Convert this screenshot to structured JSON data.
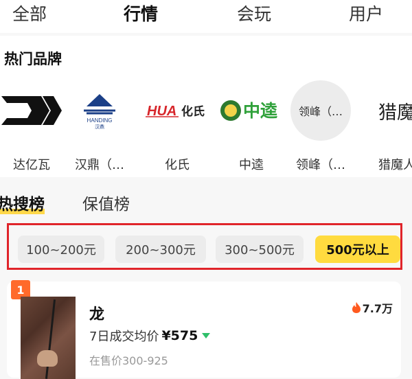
{
  "top_tabs": [
    {
      "label": "全部"
    },
    {
      "label": "行情"
    },
    {
      "label": "会玩"
    },
    {
      "label": "用户"
    }
  ],
  "brands_section": {
    "title": "热门品牌",
    "items": [
      {
        "name": "达亿瓦",
        "logo_text": "D"
      },
      {
        "name": "汉鼎（…",
        "logo_text": "HANDING 汉鼎"
      },
      {
        "name": "化氏",
        "logo_text": "HUA 化氏"
      },
      {
        "name": "中逵",
        "logo_text": "中逵"
      },
      {
        "name": "领峰（…",
        "logo_text": "领峰（…"
      },
      {
        "name": "猎魔人",
        "logo_text": "猎魔"
      }
    ]
  },
  "rank_tabs": [
    {
      "label": "热搜榜"
    },
    {
      "label": "保值榜"
    }
  ],
  "price_filters": [
    {
      "label": "100~200元"
    },
    {
      "label": "200~300元"
    },
    {
      "label": "300~500元"
    },
    {
      "label": "500元以上"
    }
  ],
  "product": {
    "rank": "1",
    "name": "龙",
    "heat": "7.7万",
    "avg_label": "7日成交均价",
    "avg_price": "¥575",
    "price_range": "在售价300-925"
  },
  "colors": {
    "accent_yellow": "#ffd84a",
    "highlight_red": "#e0242a",
    "badge_orange": "#ff6a2b",
    "trend_green": "#2fbf6a"
  },
  "icons": [
    "flame-icon",
    "down-arrow-icon"
  ]
}
